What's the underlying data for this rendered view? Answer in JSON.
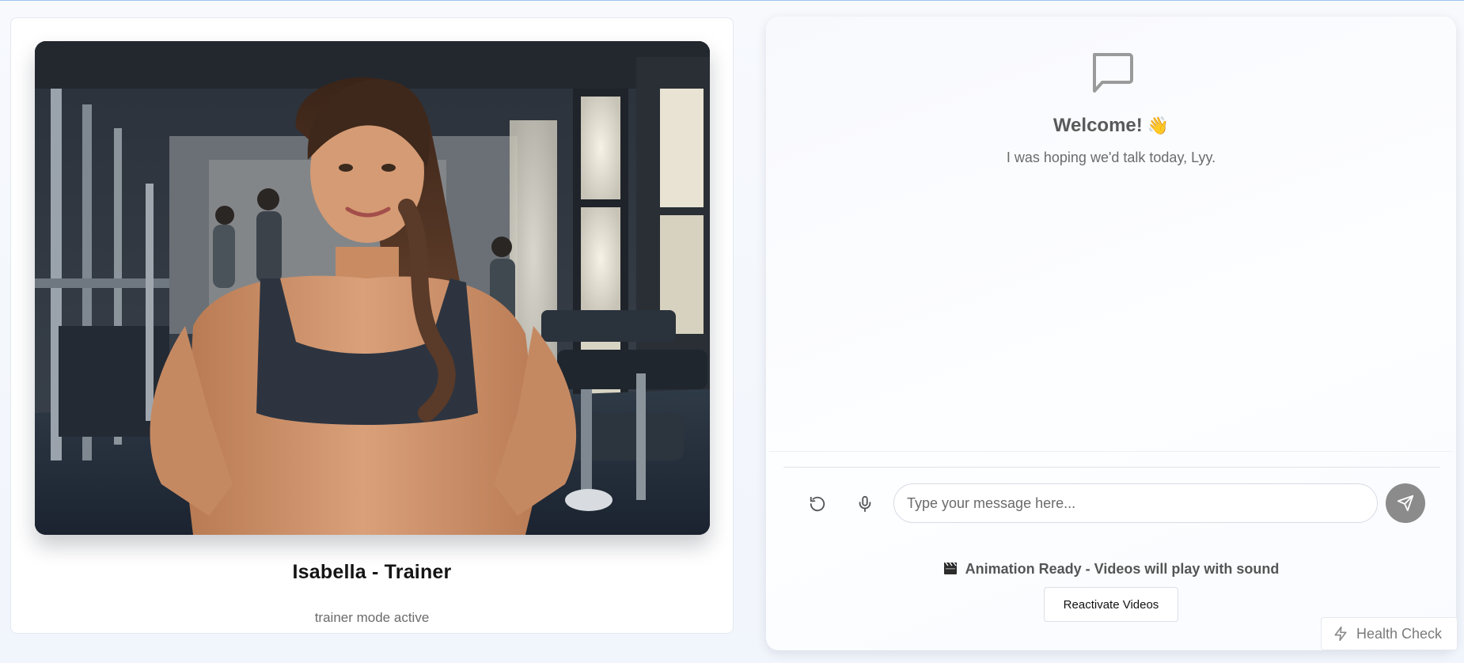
{
  "character": {
    "image_alt": "Isabella - Trainer portrait",
    "name": "Isabella - Trainer",
    "status": "trainer mode active"
  },
  "chat": {
    "empty_icon": "message-square-icon",
    "welcome_title": "Welcome!",
    "welcome_emoji": "👋",
    "welcome_subtitle": "I was hoping we'd talk today, Lyy.",
    "input_placeholder": "Type your message here...",
    "input_value": "",
    "reset_icon": "rotate-ccw-icon",
    "mic_icon": "microphone-icon",
    "send_icon": "send-icon"
  },
  "animation": {
    "status_icon": "clapperboard-icon",
    "status_text": "Animation Ready - Videos will play with sound",
    "reactivate_label": "Reactivate Videos"
  },
  "health_check": {
    "icon": "zap-icon",
    "label": "Health Check"
  },
  "colors": {
    "send_button": "#8b8b8b",
    "top_accent_line": "#9ec5ee",
    "page_background": "#f3f6fc"
  }
}
